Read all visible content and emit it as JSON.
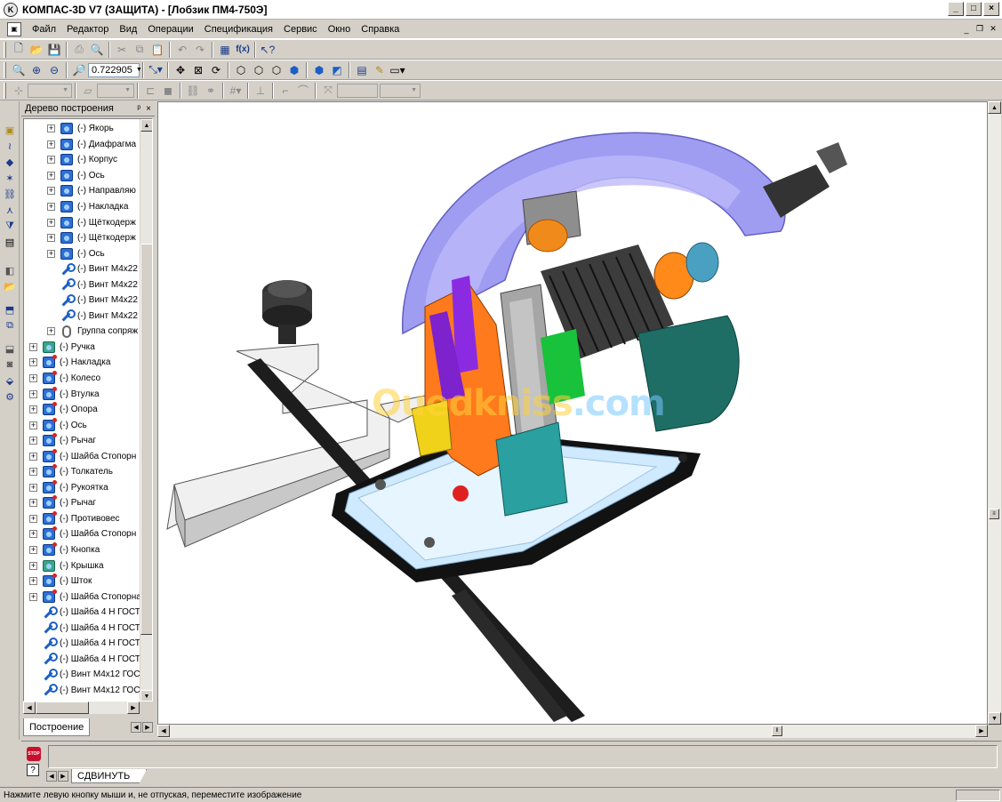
{
  "window": {
    "title": "КОМПАС-3D V7 (ЗАЩИТА) - [Лобзик ПМ4-750Э]",
    "minimize": "_",
    "maximize": "□",
    "close": "×"
  },
  "menu": {
    "items": [
      "Файл",
      "Редактор",
      "Вид",
      "Операции",
      "Спецификация",
      "Сервис",
      "Окно",
      "Справка"
    ]
  },
  "toolbar": {
    "zoom_value": "0.722905",
    "fx_label": "f(x)"
  },
  "tree": {
    "header": "Дерево построения",
    "pin": "ᵖ",
    "close": "×",
    "tab_label": "Построение",
    "items": [
      {
        "label": "(-) Якорь",
        "icon": "part-icon",
        "indent": 1,
        "expand": true
      },
      {
        "label": "(-) Диафрагма",
        "icon": "part-icon",
        "indent": 1,
        "expand": true
      },
      {
        "label": "(-) Корпус",
        "icon": "part-icon",
        "indent": 1,
        "expand": true
      },
      {
        "label": "(-) Ось",
        "icon": "part-icon",
        "indent": 1,
        "expand": true
      },
      {
        "label": "(-) Направляю",
        "icon": "part-icon",
        "indent": 1,
        "expand": true
      },
      {
        "label": "(-) Накладка",
        "icon": "part-icon",
        "indent": 1,
        "expand": true
      },
      {
        "label": "(-) Щёткодерж",
        "icon": "part-icon",
        "indent": 1,
        "expand": true
      },
      {
        "label": "(-) Щёткодерж",
        "icon": "part-icon",
        "indent": 1,
        "expand": true
      },
      {
        "label": "(-) Ось",
        "icon": "part-icon",
        "indent": 1,
        "expand": true
      },
      {
        "label": "(-) Винт М4х22",
        "icon": "wrench-icon",
        "indent": 1,
        "expand": false
      },
      {
        "label": "(-) Винт М4х22",
        "icon": "wrench-icon",
        "indent": 1,
        "expand": false
      },
      {
        "label": "(-) Винт М4х22",
        "icon": "wrench-icon",
        "indent": 1,
        "expand": false
      },
      {
        "label": "(-) Винт М4х22",
        "icon": "wrench-icon",
        "indent": 1,
        "expand": false
      },
      {
        "label": "Группа сопряж",
        "icon": "clip-icon",
        "indent": 1,
        "expand": true
      },
      {
        "label": "(-) Ручка",
        "icon": "part-green-icon",
        "indent": 0,
        "expand": true
      },
      {
        "label": "(-) Накладка",
        "icon": "part-red-icon",
        "indent": 0,
        "expand": true
      },
      {
        "label": "(-) Колесо",
        "icon": "part-red-icon",
        "indent": 0,
        "expand": true
      },
      {
        "label": "(-) Втулка",
        "icon": "part-red-icon",
        "indent": 0,
        "expand": true
      },
      {
        "label": "(-) Опора",
        "icon": "part-red-icon",
        "indent": 0,
        "expand": true
      },
      {
        "label": "(-) Ось",
        "icon": "part-red-icon",
        "indent": 0,
        "expand": true
      },
      {
        "label": "(-) Рычаг",
        "icon": "part-red-icon",
        "indent": 0,
        "expand": true
      },
      {
        "label": "(-) Шайба Стопорн",
        "icon": "part-red-icon",
        "indent": 0,
        "expand": true
      },
      {
        "label": "(-) Толкатель",
        "icon": "part-red-icon",
        "indent": 0,
        "expand": true
      },
      {
        "label": "(-) Рукоятка",
        "icon": "part-red-icon",
        "indent": 0,
        "expand": true
      },
      {
        "label": "(-) Рычаг",
        "icon": "part-red-icon",
        "indent": 0,
        "expand": true
      },
      {
        "label": "(-) Противовес",
        "icon": "part-red-icon",
        "indent": 0,
        "expand": true
      },
      {
        "label": "(-) Шайба Стопорн",
        "icon": "part-red-icon",
        "indent": 0,
        "expand": true
      },
      {
        "label": "(-) Кнопка",
        "icon": "part-red-icon",
        "indent": 0,
        "expand": true
      },
      {
        "label": "(-) Крышка",
        "icon": "part-green-icon",
        "indent": 0,
        "expand": true
      },
      {
        "label": "(-) Шток",
        "icon": "part-red-icon",
        "indent": 0,
        "expand": true
      },
      {
        "label": "(-) Шайба Стопорна",
        "icon": "part-red-icon",
        "indent": 0,
        "expand": true
      },
      {
        "label": "(-) Шайба 4 Н ГОСТ",
        "icon": "wrench-icon",
        "indent": 0,
        "expand": false
      },
      {
        "label": "(-) Шайба 4 Н ГОСТ",
        "icon": "wrench-icon",
        "indent": 0,
        "expand": false
      },
      {
        "label": "(-) Шайба 4 Н ГОСТ",
        "icon": "wrench-icon",
        "indent": 0,
        "expand": false
      },
      {
        "label": "(-) Шайба 4 Н ГОСТ",
        "icon": "wrench-icon",
        "indent": 0,
        "expand": false
      },
      {
        "label": "(-) Винт М4х12 ГОС",
        "icon": "wrench-icon",
        "indent": 0,
        "expand": false
      },
      {
        "label": "(-) Винт М4х12 ГОС",
        "icon": "wrench-icon",
        "indent": 0,
        "expand": false
      }
    ]
  },
  "viewport": {
    "watermark_a": "Ouedkniss",
    "watermark_b": ".com"
  },
  "params": {
    "stop_label": "STOP",
    "help_label": "?",
    "tab_label": "СДВИНУТЬ"
  },
  "status": {
    "message": "Нажмите левую кнопку мыши и, не отпуская, переместите изображение"
  }
}
